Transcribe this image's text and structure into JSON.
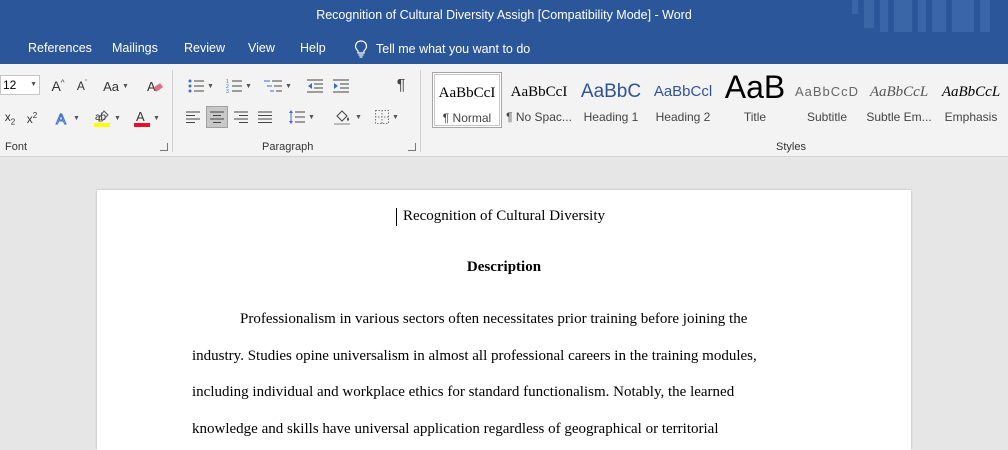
{
  "window": {
    "title": "Recognition of Cultural Diversity Assigh [Compatibility Mode]  -  Word"
  },
  "menu": {
    "tabs": [
      "References",
      "Mailings",
      "Review",
      "View",
      "Help"
    ],
    "tell_me": "Tell me what you want to do"
  },
  "ribbon": {
    "font": {
      "size_value": "12",
      "group_label": "Font"
    },
    "paragraph": {
      "group_label": "Paragraph"
    },
    "styles": {
      "group_label": "Styles",
      "items": [
        {
          "preview": "AaBbCcI",
          "name": "¶ Normal",
          "selected": true
        },
        {
          "preview": "AaBbCcI",
          "name": "¶ No Spac..."
        },
        {
          "preview": "AaBbC",
          "name": "Heading 1"
        },
        {
          "preview": "AaBbCcl",
          "name": "Heading 2"
        },
        {
          "preview": "AaB",
          "name": "Title"
        },
        {
          "preview": "AaBbCcD",
          "name": "Subtitle"
        },
        {
          "preview": "AaBbCcL",
          "name": "Subtle Em..."
        },
        {
          "preview": "AaBbCcL",
          "name": "Emphasis"
        }
      ]
    }
  },
  "document": {
    "title": "Recognition of Cultural Diversity",
    "heading": "Description",
    "paragraph_lines": [
      "Professionalism in various sectors often necessitates prior training before joining the",
      "industry. Studies opine universalism in almost all professional careers in the training modules,",
      "including individual and workplace ethics for standard functionalism. Notably, the learned",
      "knowledge and skills have universal application regardless of geographical or territorial"
    ]
  },
  "colors": {
    "accent": "#2b579a"
  }
}
